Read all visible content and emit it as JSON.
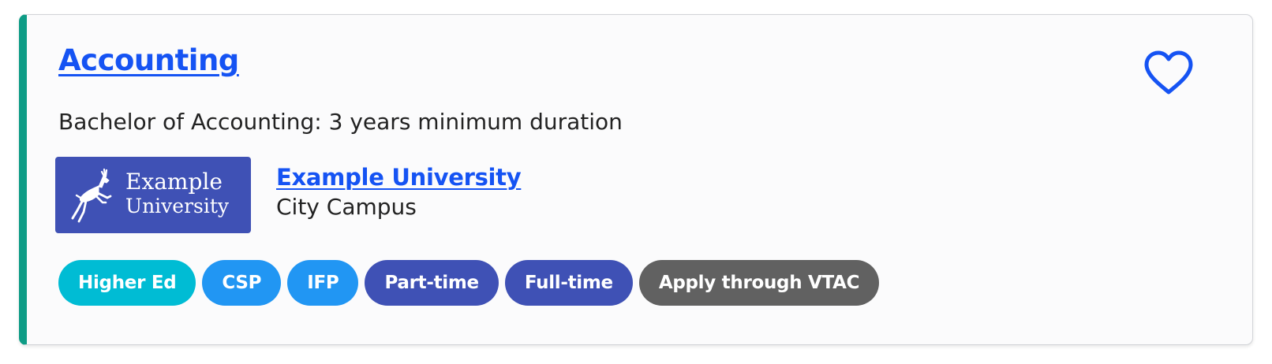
{
  "course": {
    "title": "Accounting",
    "description": "Bachelor of Accounting: 3 years minimum duration"
  },
  "favourite": {
    "icon": "heart-outline-icon",
    "color": "#1553f3"
  },
  "institution": {
    "logo_line1": "Example",
    "logo_line2": "University",
    "logo_icon": "stag-icon",
    "logo_bg": "#3f51b5",
    "name": "Example University",
    "campus": "City Campus"
  },
  "accent_color": "#0e9c86",
  "tags": [
    {
      "label": "Higher Ed",
      "color": "#00bcd4"
    },
    {
      "label": "CSP",
      "color": "#2196f3"
    },
    {
      "label": "IFP",
      "color": "#2196f3"
    },
    {
      "label": "Part-time",
      "color": "#3f51b5"
    },
    {
      "label": "Full-time",
      "color": "#3f51b5"
    },
    {
      "label": "Apply through VTAC",
      "color": "#616161"
    }
  ]
}
